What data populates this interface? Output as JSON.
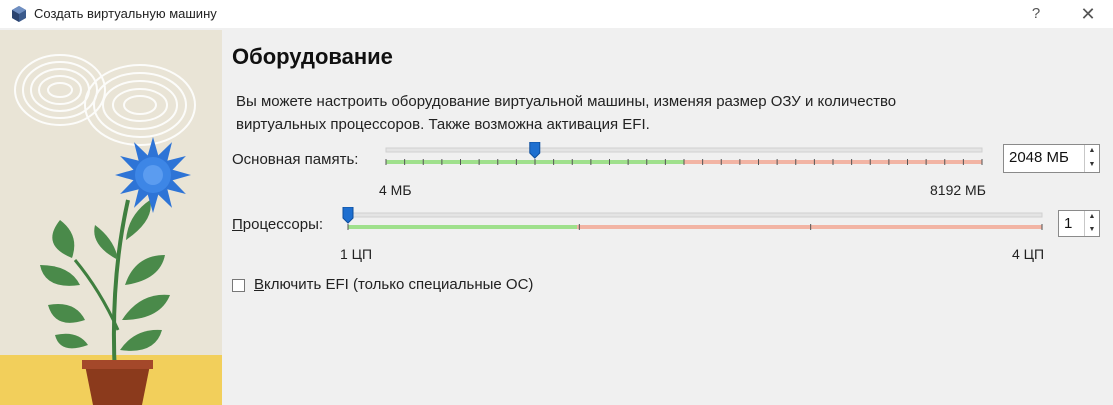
{
  "window": {
    "title": "Создать виртуальную машину",
    "help_glyph": "?",
    "close_glyph": "✕"
  },
  "page": {
    "title": "Оборудование",
    "description_lines": [
      "Вы можете настроить оборудование виртуальной машины, изменяя размер ОЗУ и количество",
      "виртуальных процессоров. Также возможна активация EFI."
    ]
  },
  "memory": {
    "label": "Основная память:",
    "value": "2048 МБ",
    "value_mb": 2048,
    "min_label": "4 МБ",
    "max_label": "8192 МБ",
    "min": 4,
    "max": 8192,
    "recommended_fraction": 0.5
  },
  "cpu": {
    "label": "Процессоры:",
    "value": "1",
    "value_num": 1,
    "min_label": "1 ЦП",
    "max_label": "4 ЦП",
    "min": 1,
    "max": 4,
    "recommended_fraction": 0.33
  },
  "efi": {
    "label": "Включить EFI (только специальные ОС)",
    "checked": false
  },
  "colors": {
    "slider_green": "#9fe08c",
    "slider_red": "#f2b4a4",
    "slider_handle": "#1e6fd0",
    "flower_blue": "#2e74d6",
    "leaf_green": "#4a8a4a",
    "pot": "#8b3a1c"
  },
  "icons": {
    "app": "virtualbox-cube-icon",
    "help": "help-icon",
    "close": "close-icon",
    "spin_up": "spin-up-arrow-icon",
    "spin_down": "spin-down-arrow-icon"
  }
}
